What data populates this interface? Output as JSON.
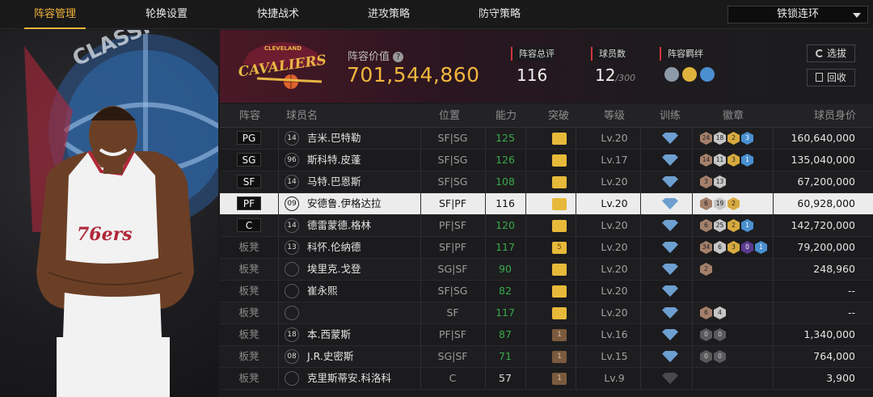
{
  "nav": {
    "tabs": [
      "阵容管理",
      "轮换设置",
      "快捷战术",
      "进攻策略",
      "防守策略"
    ],
    "active_tab": 0,
    "select_value": "铁锁连环"
  },
  "player_panel": {
    "jersey_text": "76ers",
    "logo_text": "CLASSIC"
  },
  "summary": {
    "team_logo_text": "CAVALIERS",
    "team_logo_small": "CLEVELAND",
    "value_label": "阵容价值",
    "value": "701,544,860",
    "rating_label": "阵容总评",
    "rating": "116",
    "count_label": "球员数",
    "count": "12",
    "count_max": "/300",
    "bond_label": "阵容羁绊",
    "buttons": {
      "pick": "选拔",
      "recycle": "回收"
    },
    "colors": {
      "accent": "#f2b63d",
      "red_mark": "#d0343c"
    }
  },
  "table": {
    "headers": [
      "阵容",
      "球员名",
      "位置",
      "能力",
      "突破",
      "等级",
      "训练",
      "徽章",
      "球员身价"
    ],
    "rows": [
      {
        "slot": "PG",
        "bench": false,
        "num": "14",
        "name": "吉米.巴特勒",
        "role": "SF|SG",
        "ability": "125",
        "break": "",
        "breakColor": "gold",
        "level": "Lv.20",
        "train": true,
        "badges": [
          [
            "bronze",
            "24"
          ],
          [
            "silver",
            "18"
          ],
          [
            "gold",
            "2"
          ],
          [
            "blue",
            "3"
          ]
        ],
        "worth": "160,640,000"
      },
      {
        "slot": "SG",
        "bench": false,
        "num": "96",
        "name": "斯科特.皮蓬",
        "role": "SF|SG",
        "ability": "126",
        "break": "",
        "breakColor": "gold",
        "level": "Lv.17",
        "train": true,
        "badges": [
          [
            "bronze",
            "14"
          ],
          [
            "silver",
            "11"
          ],
          [
            "gold",
            "3"
          ],
          [
            "blue",
            "1"
          ]
        ],
        "worth": "135,040,000"
      },
      {
        "slot": "SF",
        "bench": false,
        "num": "14",
        "name": "马特.巴恩斯",
        "role": "SF|SG",
        "ability": "108",
        "break": "",
        "breakColor": "gold",
        "level": "Lv.20",
        "train": true,
        "badges": [
          [
            "bronze",
            "3"
          ],
          [
            "silver",
            "13"
          ]
        ],
        "worth": "67,200,000"
      },
      {
        "slot": "PF",
        "bench": false,
        "num": "09",
        "name": "安德鲁.伊格达拉",
        "role": "SF|PF",
        "ability": "116",
        "break": "",
        "breakColor": "gold",
        "level": "Lv.20",
        "train": true,
        "badges": [
          [
            "bronze",
            "6"
          ],
          [
            "silver",
            "19"
          ],
          [
            "gold",
            "2"
          ]
        ],
        "worth": "60,928,000",
        "selected": true
      },
      {
        "slot": "C",
        "bench": false,
        "num": "14",
        "name": "德雷蒙德.格林",
        "role": "PF|SF",
        "ability": "120",
        "break": "",
        "breakColor": "gold",
        "level": "Lv.20",
        "train": true,
        "badges": [
          [
            "bronze",
            "6"
          ],
          [
            "silver",
            "25"
          ],
          [
            "gold",
            "2"
          ],
          [
            "blue",
            "1"
          ]
        ],
        "worth": "142,720,000"
      },
      {
        "slot": "板凳",
        "bench": true,
        "num": "13",
        "name": "科怀.伦纳德",
        "role": "SF|PF",
        "ability": "117",
        "break": "5",
        "breakColor": "gold",
        "level": "Lv.20",
        "train": true,
        "badges": [
          [
            "bronze",
            "34"
          ],
          [
            "silver",
            "6"
          ],
          [
            "gold",
            "3"
          ],
          [
            "purple",
            "0"
          ],
          [
            "blue",
            "1"
          ]
        ],
        "worth": "79,200,000"
      },
      {
        "slot": "板凳",
        "bench": true,
        "num": "",
        "name": "埃里克.戈登",
        "role": "SG|SF",
        "ability": "90",
        "break": "",
        "breakColor": "gold",
        "level": "Lv.20",
        "train": true,
        "badges": [
          [
            "bronze",
            "2"
          ]
        ],
        "worth": "248,960"
      },
      {
        "slot": "板凳",
        "bench": true,
        "num": "",
        "name": "崔永熙",
        "role": "SF|SG",
        "ability": "82",
        "break": "",
        "breakColor": "gold",
        "level": "Lv.20",
        "train": true,
        "badges": [],
        "worth": "--"
      },
      {
        "slot": "板凳",
        "bench": true,
        "num": "",
        "name": "",
        "role": "SF",
        "ability": "117",
        "break": "",
        "breakColor": "gold",
        "level": "Lv.20",
        "train": true,
        "badges": [
          [
            "bronze",
            "6"
          ],
          [
            "silver",
            "4"
          ]
        ],
        "worth": "--"
      },
      {
        "slot": "板凳",
        "bench": true,
        "num": "18",
        "name": "本.西蒙斯",
        "role": "PF|SF",
        "ability": "87",
        "break": "1",
        "breakColor": "brown",
        "level": "Lv.16",
        "train": true,
        "badges": [
          [
            "gray",
            "0"
          ],
          [
            "gray",
            "0"
          ]
        ],
        "worth": "1,340,000"
      },
      {
        "slot": "板凳",
        "bench": true,
        "num": "08",
        "name": "J.R.史密斯",
        "role": "SG|SF",
        "ability": "71",
        "break": "1",
        "breakColor": "brown",
        "level": "Lv.15",
        "train": true,
        "badges": [
          [
            "gray",
            "0"
          ],
          [
            "gray",
            "0"
          ]
        ],
        "worth": "764,000"
      },
      {
        "slot": "板凳",
        "bench": true,
        "num": "",
        "name": "克里斯蒂安.科洛科",
        "role": "C",
        "ability": "57",
        "break": "1",
        "breakColor": "brown",
        "level": "Lv.9",
        "train": false,
        "badges": [],
        "worth": "3,900"
      }
    ]
  }
}
